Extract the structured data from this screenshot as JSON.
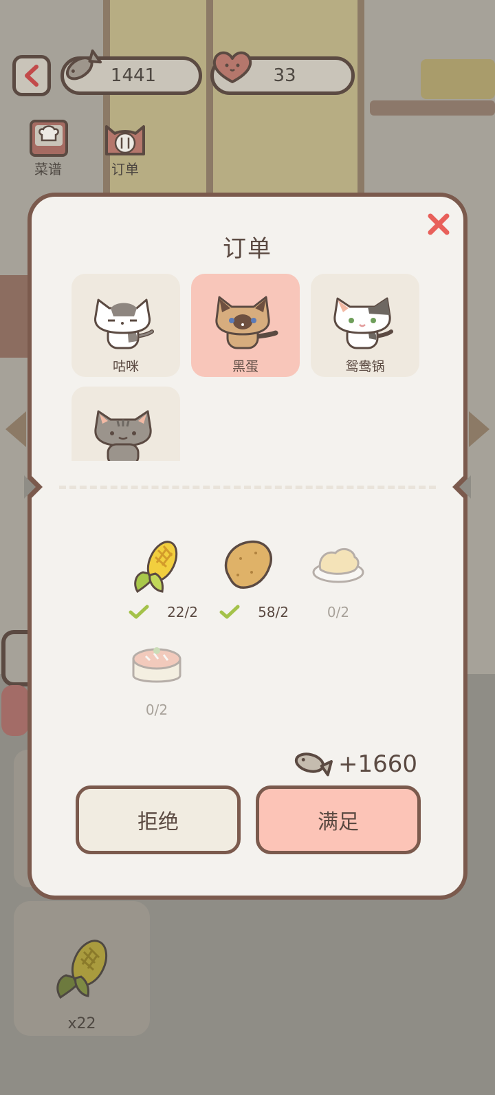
{
  "hud": {
    "fish_count": "1441",
    "heart_count": "33"
  },
  "side_menu": {
    "recipe_label": "菜谱",
    "orders_label": "订单"
  },
  "dialog": {
    "title": "订单",
    "cats": [
      {
        "name": "咕咪",
        "selected": false
      },
      {
        "name": "黑蛋",
        "selected": true
      },
      {
        "name": "鸳鸯锅",
        "selected": false
      },
      {
        "name": "",
        "selected": false
      }
    ],
    "ingredients": [
      {
        "icon": "corn-icon",
        "count": "22/2",
        "complete": true
      },
      {
        "icon": "potato-icon",
        "count": "58/2",
        "complete": true
      },
      {
        "icon": "rice-plate-icon",
        "count": "0/2",
        "complete": false
      },
      {
        "icon": "fish-cake-icon",
        "count": "0/2",
        "complete": false
      }
    ],
    "reward": "+1660",
    "reject_label": "拒绝",
    "accept_label": "满足"
  },
  "background": {
    "inventory_qty": "x22"
  },
  "colors": {
    "border": "#7b5a4d",
    "panel": "#f4f2ee",
    "selected_card": "#f8c6ba",
    "accept_button": "#fcc4b7",
    "close_x": "#e8605a",
    "check": "#a4c24a"
  }
}
